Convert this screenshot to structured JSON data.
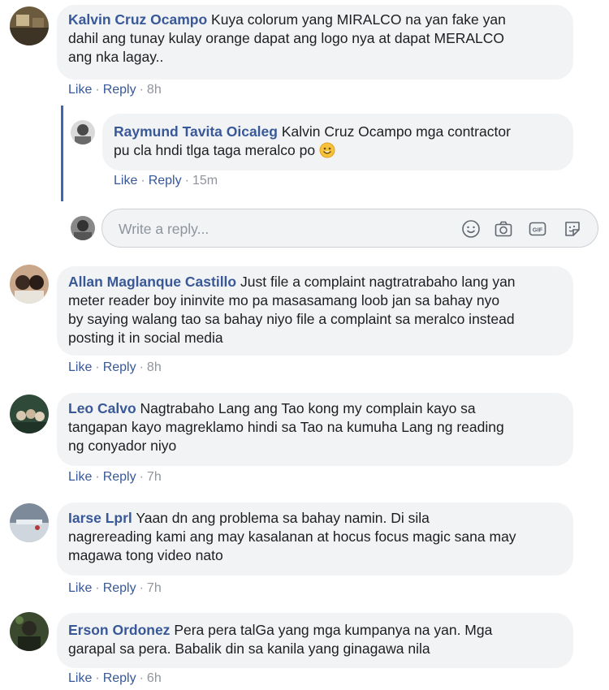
{
  "meta_labels": {
    "like": "Like",
    "reply": "Reply",
    "separator": "·"
  },
  "comments": [
    {
      "author": "Kalvin Cruz Ocampo",
      "lines": [
        "Kuya colorum yang MIRALCO na yan fake yan",
        "dahil ang tunay kulay orange dapat ang logo nya at dapat MERALCO",
        "ang nka lagay.."
      ],
      "time": "8h"
    },
    {
      "author": "Raymund Tavita Oicaleg",
      "lines": [
        "Kalvin Cruz Ocampo mga contractor",
        "pu cla hndi tlga taga meralco po"
      ],
      "time": "15m"
    },
    {
      "author": "Allan Maglanque Castillo",
      "lines": [
        "Just file a complaint nagtratrabaho lang yan",
        "meter reader boy ininvite mo pa masasamang loob jan sa bahay nyo",
        "by saying walang tao sa bahay niyo file a complaint sa meralco instead",
        "posting it in social media"
      ],
      "time": "8h"
    },
    {
      "author": "Leo Calvo",
      "lines": [
        "Nagtrabaho Lang ang Tao kong my complain kayo sa",
        "tangapan kayo magreklamo hindi sa Tao na kumuha Lang ng reading",
        "ng conyador niyo"
      ],
      "time": "7h"
    },
    {
      "author": "Iarse Lprl",
      "lines": [
        "Yaan dn ang problema sa bahay namin. Di sila",
        "nagrereading kami ang may kasalanan at hocus focus magic sana may",
        "magawa tong video nato"
      ],
      "time": "7h"
    },
    {
      "author": "Erson Ordonez",
      "lines": [
        "Pera pera talGa yang mga kumpanya na yan. Mga",
        "garapal sa pera. Babalik din sa kanila yang ginagawa nila"
      ],
      "time": "6h"
    }
  ],
  "reply_box": {
    "placeholder": "Write a reply..."
  },
  "colors": {
    "link": "#385898",
    "bubble": "#f2f3f5",
    "thread_bar": "#4267b2",
    "meta": "#90949c"
  }
}
